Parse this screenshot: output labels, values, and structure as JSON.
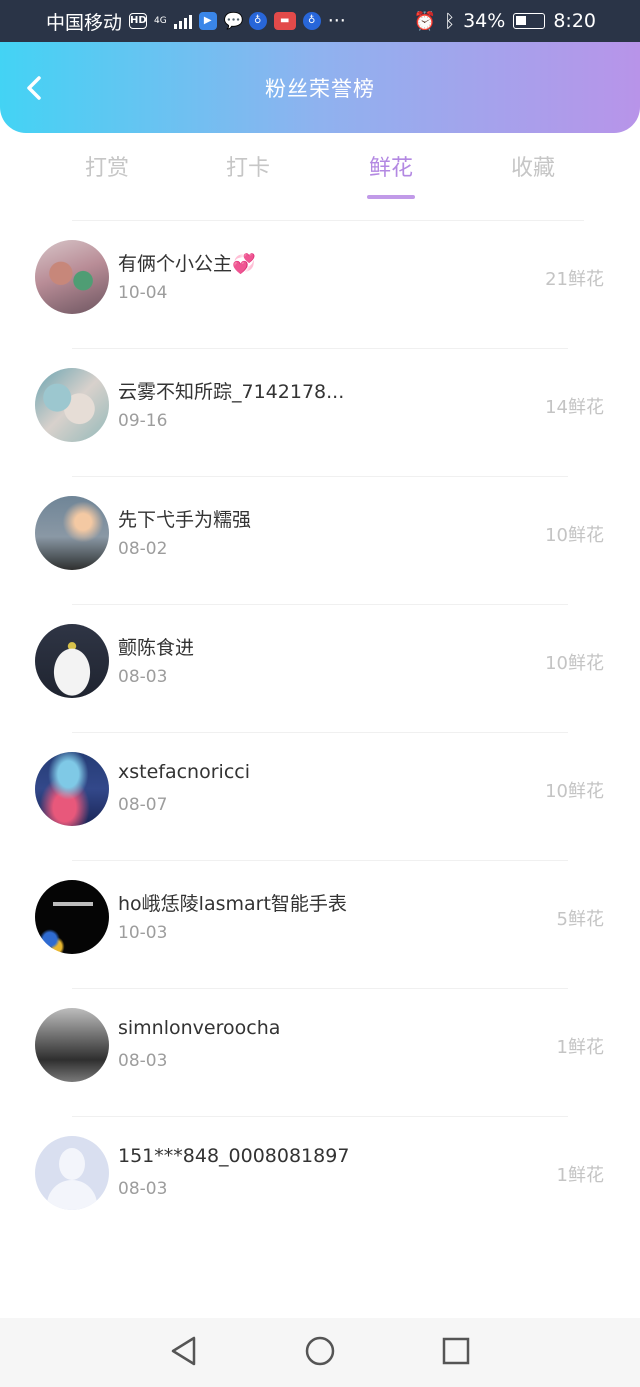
{
  "status_bar": {
    "carrier": "中国移动",
    "hd_badge": "HD",
    "network": "4G",
    "more_indicator": "···",
    "battery": "34%",
    "time": "8:20"
  },
  "header": {
    "title": "粉丝荣誉榜",
    "gradient_start": "#43d3f4",
    "gradient_end": "#b894e9"
  },
  "tabs": [
    {
      "label": "打赏",
      "active": false
    },
    {
      "label": "打卡",
      "active": false
    },
    {
      "label": "鲜花",
      "active": true
    },
    {
      "label": "收藏",
      "active": false
    }
  ],
  "accent_color": "#b388e2",
  "fans": [
    {
      "name": "有俩个小公主💞",
      "date": "10-04",
      "count": "21鲜花"
    },
    {
      "name": "云雾不知所踪_7142178...",
      "date": "09-16",
      "count": "14鲜花"
    },
    {
      "name": "先下弋手为糯强",
      "date": "08-02",
      "count": "10鲜花"
    },
    {
      "name": "颤陈食进",
      "date": "08-03",
      "count": "10鲜花"
    },
    {
      "name": "xstefacnoricci",
      "date": "08-07",
      "count": "10鲜花"
    },
    {
      "name": "ho峨恁陵lasmart智能手表",
      "date": "10-03",
      "count": "5鲜花"
    },
    {
      "name": "simnlonveroocha",
      "date": "08-03",
      "count": "1鲜花"
    },
    {
      "name": "151***848_0008081897",
      "date": "08-03",
      "count": "1鲜花"
    }
  ],
  "nav_bar": {
    "back_icon": "triangle-back-icon",
    "home_icon": "circle-home-icon",
    "recents_icon": "square-recents-icon"
  }
}
